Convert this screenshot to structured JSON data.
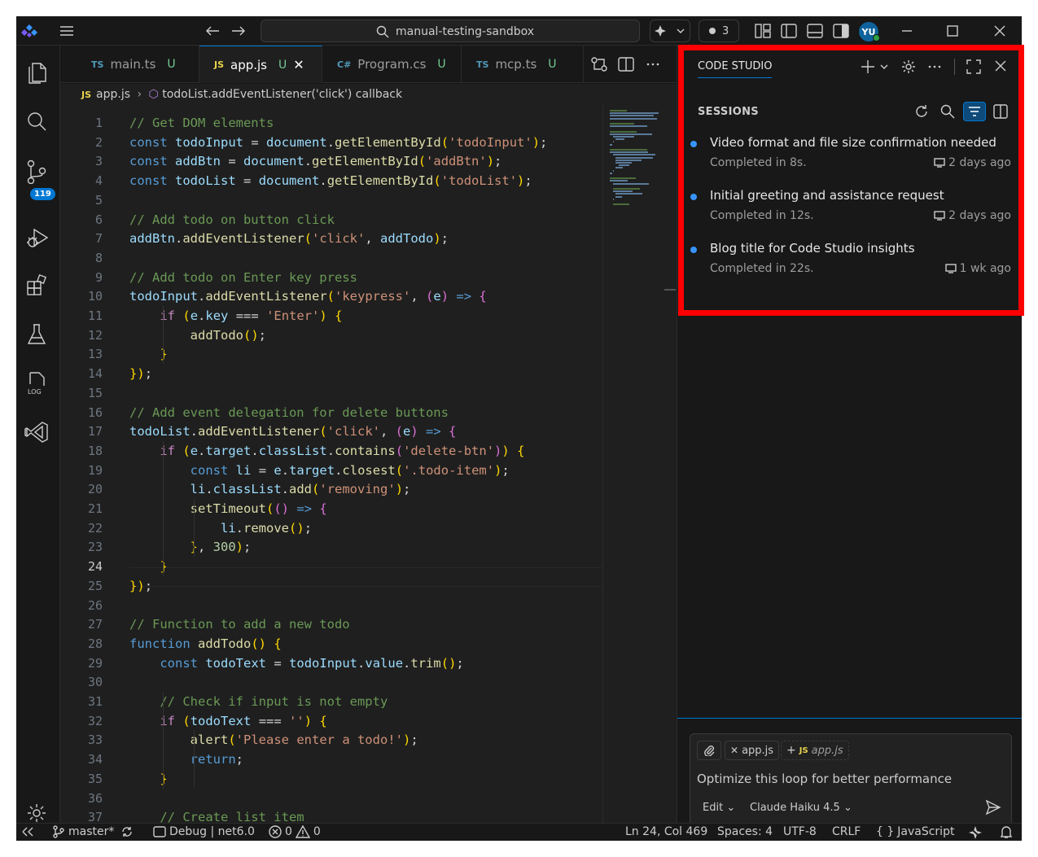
{
  "titlebar": {
    "search_text": "manual-testing-sandbox",
    "pending_count": "3",
    "avatar_initials": "YU"
  },
  "activity": {
    "scm_badge": "119"
  },
  "tabs": [
    {
      "lang": "TS",
      "label": "main.ts",
      "status": "U"
    },
    {
      "lang": "JS",
      "label": "app.js",
      "status": "U"
    },
    {
      "lang": "C#",
      "label": "Program.cs",
      "status": "U"
    },
    {
      "lang": "TS",
      "label": "mcp.ts",
      "status": "U"
    }
  ],
  "breadcrumb": {
    "lang": "JS",
    "file": "app.js",
    "symbol": "todoList.addEventListener('click') callback"
  },
  "editor": {
    "current_line": 24,
    "lines": [
      "// Get DOM elements",
      "const todoInput = document.getElementById('todoInput');",
      "const addBtn = document.getElementById('addBtn');",
      "const todoList = document.getElementById('todoList');",
      "",
      "// Add todo on button click",
      "addBtn.addEventListener('click', addTodo);",
      "",
      "// Add todo on Enter key press",
      "todoInput.addEventListener('keypress', (e) => {",
      "    if (e.key === 'Enter') {",
      "        addTodo();",
      "    }",
      "});",
      "",
      "// Add event delegation for delete buttons",
      "todoList.addEventListener('click', (e) => {",
      "    if (e.target.classList.contains('delete-btn')) {",
      "        const li = e.target.closest('.todo-item');",
      "        li.classList.add('removing');",
      "        setTimeout(() => {",
      "            li.remove();",
      "        }, 300);",
      "    }",
      "});",
      "",
      "// Function to add a new todo",
      "function addTodo() {",
      "    const todoText = todoInput.value.trim();",
      "",
      "    // Check if input is not empty",
      "    if (todoText === '') {",
      "        alert('Please enter a todo!');",
      "        return;",
      "    }",
      "",
      "    // Create list item"
    ]
  },
  "panel": {
    "title": "CODE STUDIO",
    "section": "SESSIONS",
    "sessions": [
      {
        "title": "Video format and file size confirmation needed",
        "status": "Completed in 8s.",
        "when": "2 days ago"
      },
      {
        "title": "Initial greeting and assistance request",
        "status": "Completed in 12s.",
        "when": "2 days ago"
      },
      {
        "title": "Blog title for Code Studio insights",
        "status": "Completed in 22s.",
        "when": "1 wk ago"
      }
    ],
    "chat": {
      "chip1": "app.js",
      "chip2_lang": "JS",
      "chip2": "app.js",
      "input": "Optimize this loop for better performance",
      "mode": "Edit",
      "model": "Claude Haiku 4.5"
    }
  },
  "status": {
    "branch": "master*",
    "debug": "Debug | net6.0",
    "errors": "0",
    "warnings": "0",
    "position": "Ln 24, Col 469",
    "spaces": "Spaces: 4",
    "encoding": "UTF-8",
    "eol": "CRLF",
    "language": "JavaScript"
  },
  "colors": {
    "accent": "#0078d4",
    "highlight": "#ff0000",
    "dot": "#3794ff"
  }
}
